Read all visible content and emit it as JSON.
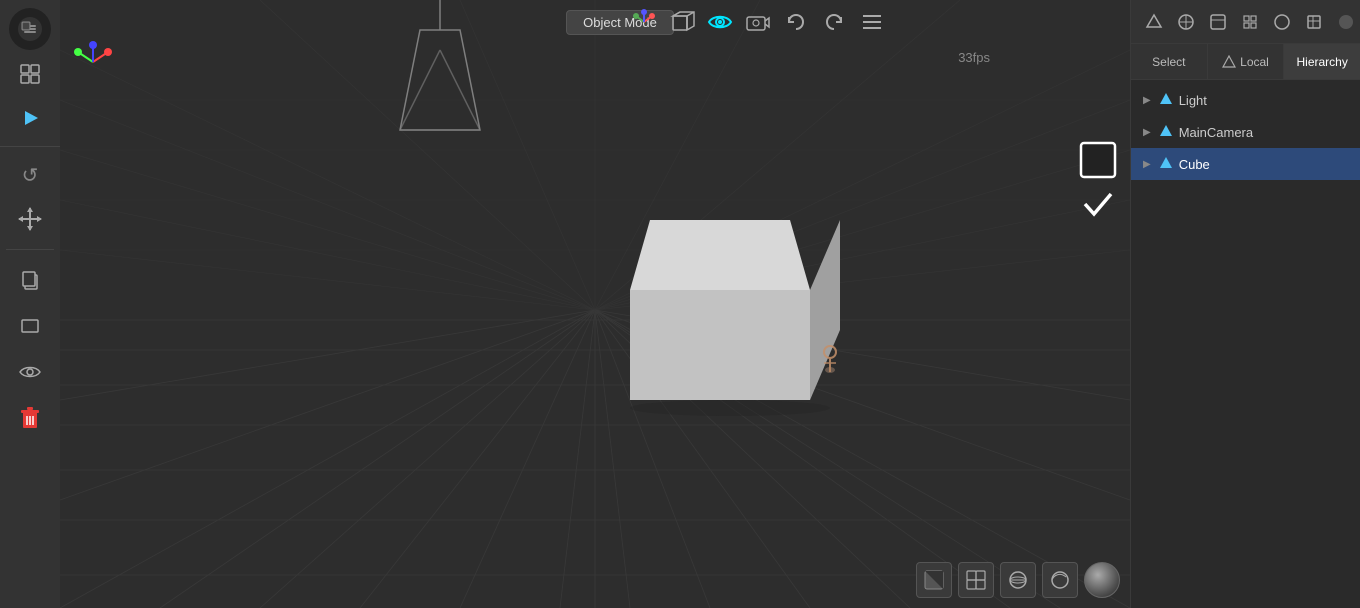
{
  "toolbar": {
    "top_icons": [
      {
        "name": "blender-logo-icon",
        "symbol": "◻",
        "label": "Blender logo"
      },
      {
        "name": "layout-icon",
        "symbol": "⊡",
        "label": "Layout"
      },
      {
        "name": "play-icon",
        "symbol": "▶",
        "label": "Play"
      }
    ],
    "refresh_icon": "↺",
    "move_icon": "✛",
    "items": [
      {
        "name": "copy-icon",
        "symbol": "⧉"
      },
      {
        "name": "rect-icon",
        "symbol": "▭"
      },
      {
        "name": "eye-icon",
        "symbol": "👁"
      },
      {
        "name": "trash-icon",
        "symbol": "🗑"
      }
    ]
  },
  "viewport": {
    "mode_label": "Object Mode",
    "fps_label": "33fps"
  },
  "nav_icons": [
    {
      "name": "gizmo-icon",
      "symbol": "⊕"
    },
    {
      "name": "cube-view-icon",
      "symbol": "⬛"
    },
    {
      "name": "eye-render-icon",
      "symbol": "👁"
    },
    {
      "name": "camera-icon",
      "symbol": "🎥"
    },
    {
      "name": "undo-icon",
      "symbol": "↩"
    },
    {
      "name": "redo-icon",
      "symbol": "↪"
    },
    {
      "name": "menu-icon",
      "symbol": "☰"
    }
  ],
  "right_panel": {
    "header_tabs": [
      {
        "name": "select-tab",
        "label": "Select",
        "active": false
      },
      {
        "name": "local-tab",
        "label": "Local",
        "active": false,
        "has_icon": true
      },
      {
        "name": "hierarchy-tab",
        "label": "Hierarchy",
        "active": true
      }
    ],
    "hierarchy_items": [
      {
        "name": "light-item",
        "label": "Light",
        "icon": "▶",
        "type": "light"
      },
      {
        "name": "main-camera-item",
        "label": "MainCamera",
        "icon": "▶",
        "type": "camera"
      },
      {
        "name": "cube-item",
        "label": "Cube",
        "icon": "▶",
        "type": "cube",
        "selected": true
      }
    ]
  },
  "bottom_icons": [
    {
      "name": "shading-solid-icon",
      "symbol": "◼"
    },
    {
      "name": "shading-wire-icon",
      "symbol": "⊞"
    },
    {
      "name": "shading-material-icon",
      "symbol": "⬡"
    },
    {
      "name": "shading-rendered-icon",
      "symbol": "⬡"
    }
  ],
  "colors": {
    "background": "#2d2d2d",
    "toolbar_bg": "#333333",
    "panel_bg": "#2a2a2a",
    "selected_bg": "#2d4a7a",
    "accent_cyan": "#00e5ff",
    "grid_color": "#3a3a3a",
    "cube_face_top": "#d0d0d0",
    "cube_face_front": "#b0b0b0",
    "cube_face_side": "#909090"
  }
}
